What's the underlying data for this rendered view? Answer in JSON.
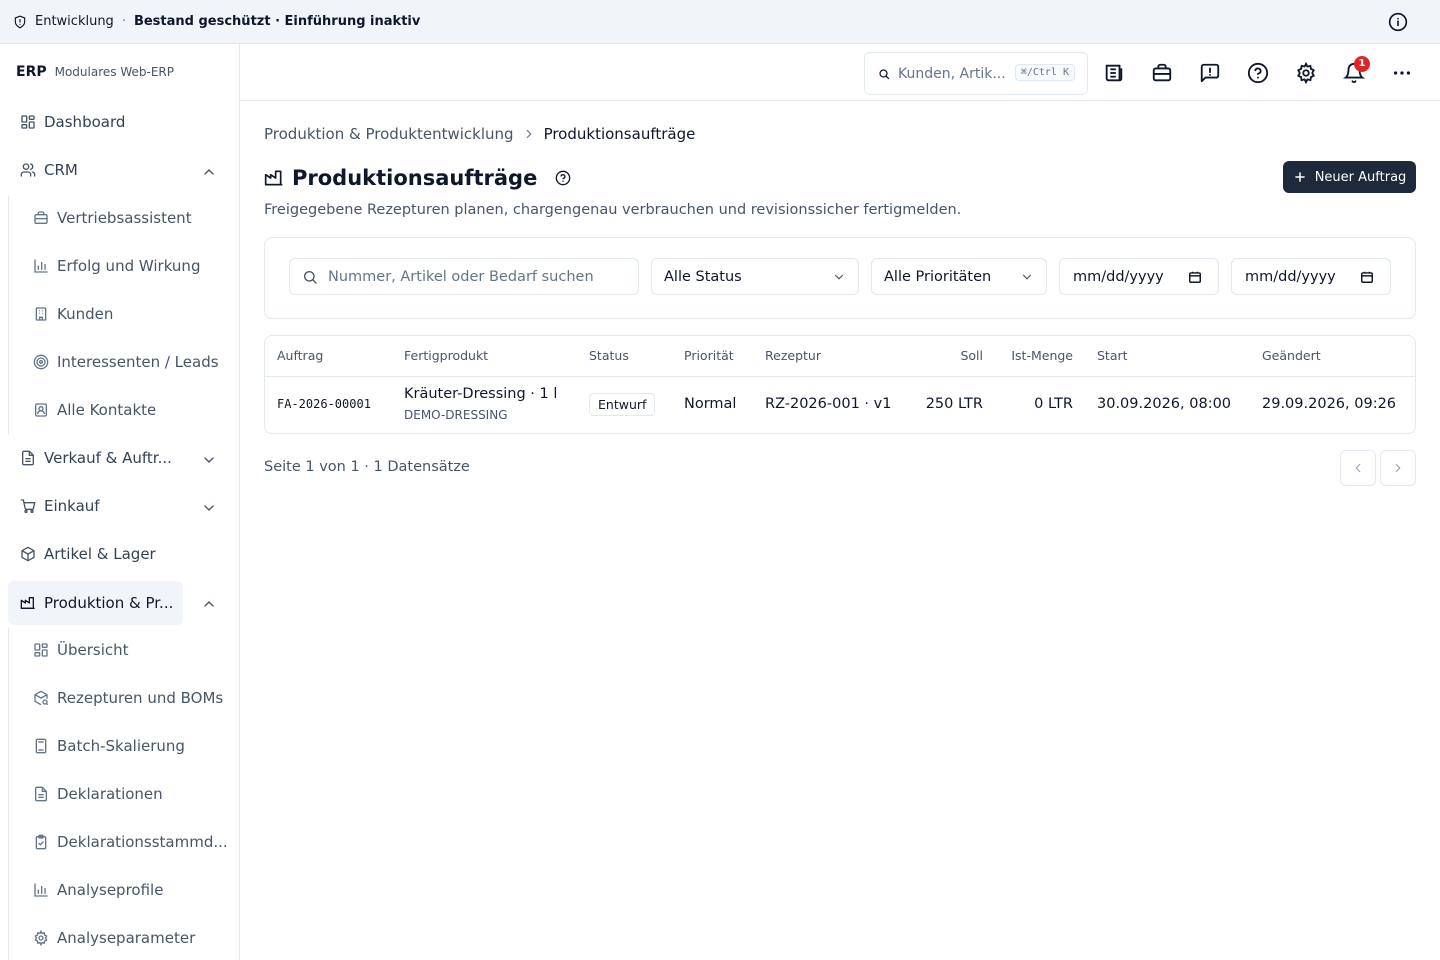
{
  "banner": {
    "environment": "Entwicklung",
    "separator": "·",
    "status": "Bestand geschützt · Einführung inaktiv"
  },
  "sidebar": {
    "brand": "ERP",
    "brand_subtitle": "Modulares Web-ERP",
    "items": {
      "dashboard": "Dashboard",
      "crm": "CRM",
      "crm_sub": [
        "Vertriebsassistent",
        "Erfolg und Wirkung",
        "Kunden",
        "Interessenten / Leads",
        "Alle Kontakte"
      ],
      "verkauf": "Verkauf & Auftr...",
      "einkauf": "Einkauf",
      "artikel": "Artikel & Lager",
      "produktion": "Produktion & Pr...",
      "produktion_sub": [
        "Übersicht",
        "Rezepturen und BOMs",
        "Batch-Skalierung",
        "Deklarationen",
        "Deklarationsstammd...",
        "Analyseprofile",
        "Analyseparameter"
      ]
    }
  },
  "topbar": {
    "search_placeholder": "Kunden, Artik...",
    "search_shortcut": "⌘/Ctrl K",
    "notification_count": "1"
  },
  "breadcrumb": {
    "parent": "Produktion & Produktentwicklung",
    "current": "Produktionsaufträge"
  },
  "page": {
    "title": "Produktionsaufträge",
    "description": "Freigegebene Rezepturen planen, chargengenau verbrauchen und revisionssicher fertigmelden.",
    "new_button": "Neuer Auftrag"
  },
  "filters": {
    "search_placeholder": "Nummer, Artikel oder Bedarf suchen",
    "status_selected": "Alle Status",
    "priority_selected": "Alle Prioritäten",
    "date_from": "mm/dd/yyyy",
    "date_to": "mm/dd/yyyy"
  },
  "table": {
    "columns": [
      "Auftrag",
      "Fertigprodukt",
      "Status",
      "Priorität",
      "Rezeptur",
      "Soll",
      "Ist-Menge",
      "Start",
      "Geändert"
    ],
    "rows": [
      {
        "auftrag": "FA-2026-00001",
        "produkt": "Kräuter-Dressing · 1 l",
        "sku": "DEMO-DRESSING",
        "status": "Entwurf",
        "prioritaet": "Normal",
        "rezeptur": "RZ-2026-001 · v1",
        "soll": "250 LTR",
        "ist": "0 LTR",
        "start": "30.09.2026, 08:00",
        "geaendert": "29.09.2026, 09:26"
      }
    ]
  },
  "pagination": {
    "summary": "Seite 1 von 1 · 1 Datensätze"
  }
}
